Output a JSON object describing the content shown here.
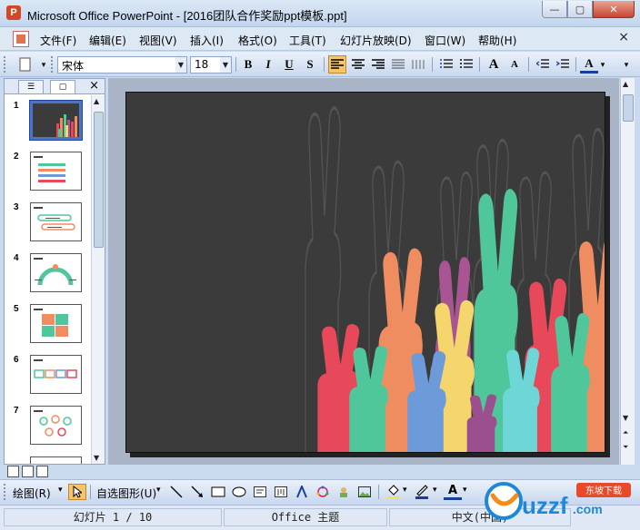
{
  "window": {
    "title": "Microsoft Office PowerPoint - [2016团队合作奖励ppt模板.ppt]",
    "icon": "powerpoint-icon"
  },
  "menu": {
    "items": [
      "文件(F)",
      "编辑(E)",
      "视图(V)",
      "插入(I)",
      "格式(O)",
      "工具(T)",
      "幻灯片放映(D)",
      "窗口(W)",
      "帮助(H)"
    ],
    "close": "×"
  },
  "format_toolbar": {
    "font_name": "宋体",
    "font_size": "18",
    "bold": "B",
    "italic": "I",
    "underline": "U",
    "shadow": "S",
    "grow_font": "A",
    "shrink_font": "A",
    "font_color": "A",
    "align_left_active": true
  },
  "slides_panel": {
    "thumbnails": [
      {
        "num": "1",
        "selected": true
      },
      {
        "num": "2",
        "selected": false
      },
      {
        "num": "3",
        "selected": false
      },
      {
        "num": "4",
        "selected": false
      },
      {
        "num": "5",
        "selected": false
      },
      {
        "num": "6",
        "selected": false
      },
      {
        "num": "7",
        "selected": false
      }
    ],
    "close": "×"
  },
  "slide": {
    "background": "#3b3b3b",
    "hand_colors": [
      "#e8495a",
      "#f08d60",
      "#4fc79a",
      "#a95493",
      "#f5d66d",
      "#6d9ad8",
      "#6fd6d8",
      "#9c4f8f"
    ]
  },
  "draw_toolbar": {
    "draw_label": "绘图(R)",
    "autoshapes_label": "自选图形(U)"
  },
  "status": {
    "slide_info": "幻灯片 1 / 10",
    "theme": "Office 主题",
    "language": "中文(中国)"
  },
  "watermark": {
    "logo_text": "uzzf.com",
    "tag_text": "东坡下载"
  }
}
